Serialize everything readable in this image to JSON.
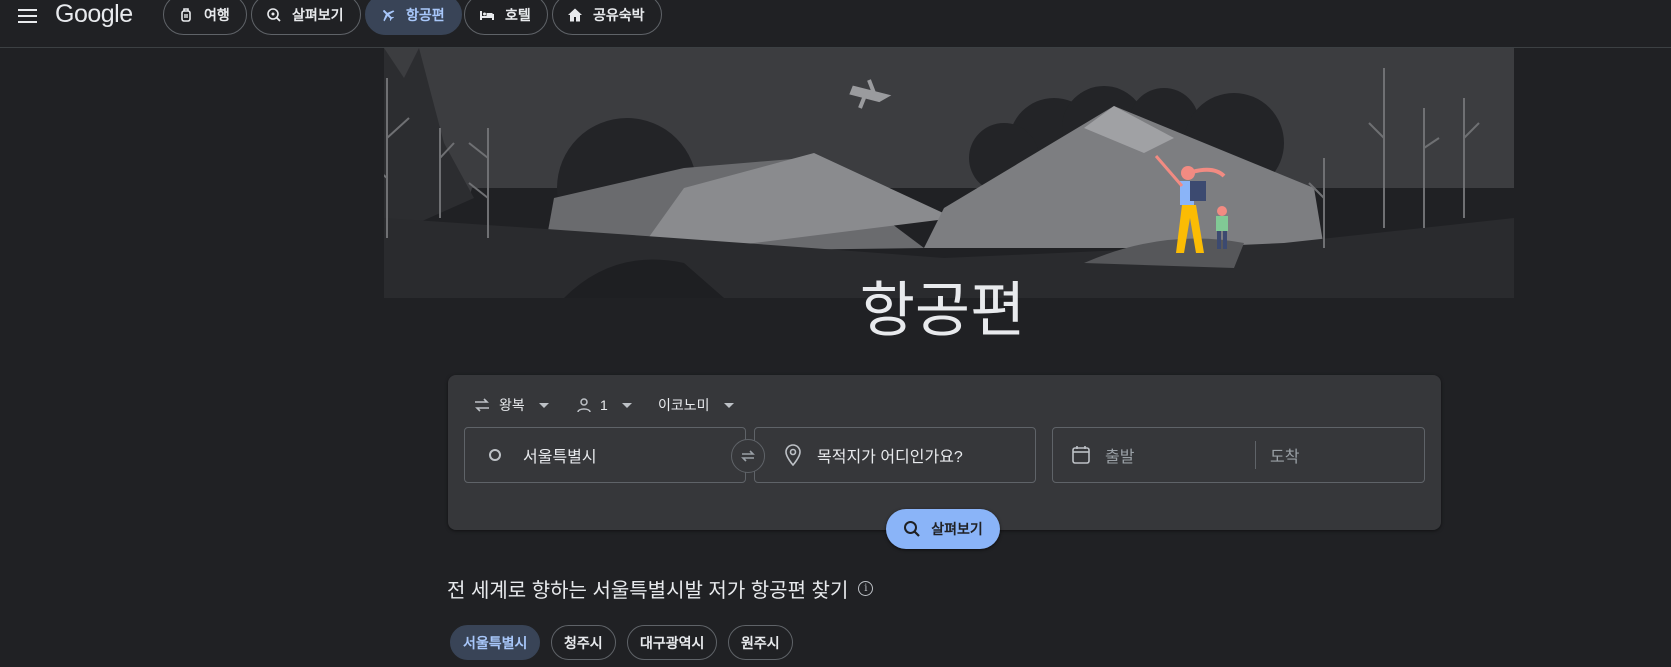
{
  "header": {
    "logo": "Google",
    "nav": [
      {
        "label": "여행",
        "icon": "luggage-icon"
      },
      {
        "label": "살펴보기",
        "icon": "explore-icon"
      },
      {
        "label": "항공편",
        "icon": "airplane-icon",
        "active": true
      },
      {
        "label": "호텔",
        "icon": "bed-icon"
      },
      {
        "label": "공유숙박",
        "icon": "home-icon"
      }
    ]
  },
  "hero": {
    "title": "항공편"
  },
  "search": {
    "trip_type": "왕복",
    "passengers": "1",
    "cabin_class": "이코노미",
    "origin": "서울특별시",
    "destination_placeholder": "목적지가 어디인가요?",
    "depart_placeholder": "출발",
    "return_placeholder": "도착",
    "search_label": "살펴보기"
  },
  "explore": {
    "title": "전 세계로 향하는 서울특별시발 저가 항공편 찾기",
    "cities": [
      "서울특별시",
      "청주시",
      "대구광역시",
      "원주시"
    ]
  },
  "colors": {
    "background": "#202124",
    "accent": "#8ab4f8",
    "active_chip": "#394457"
  }
}
